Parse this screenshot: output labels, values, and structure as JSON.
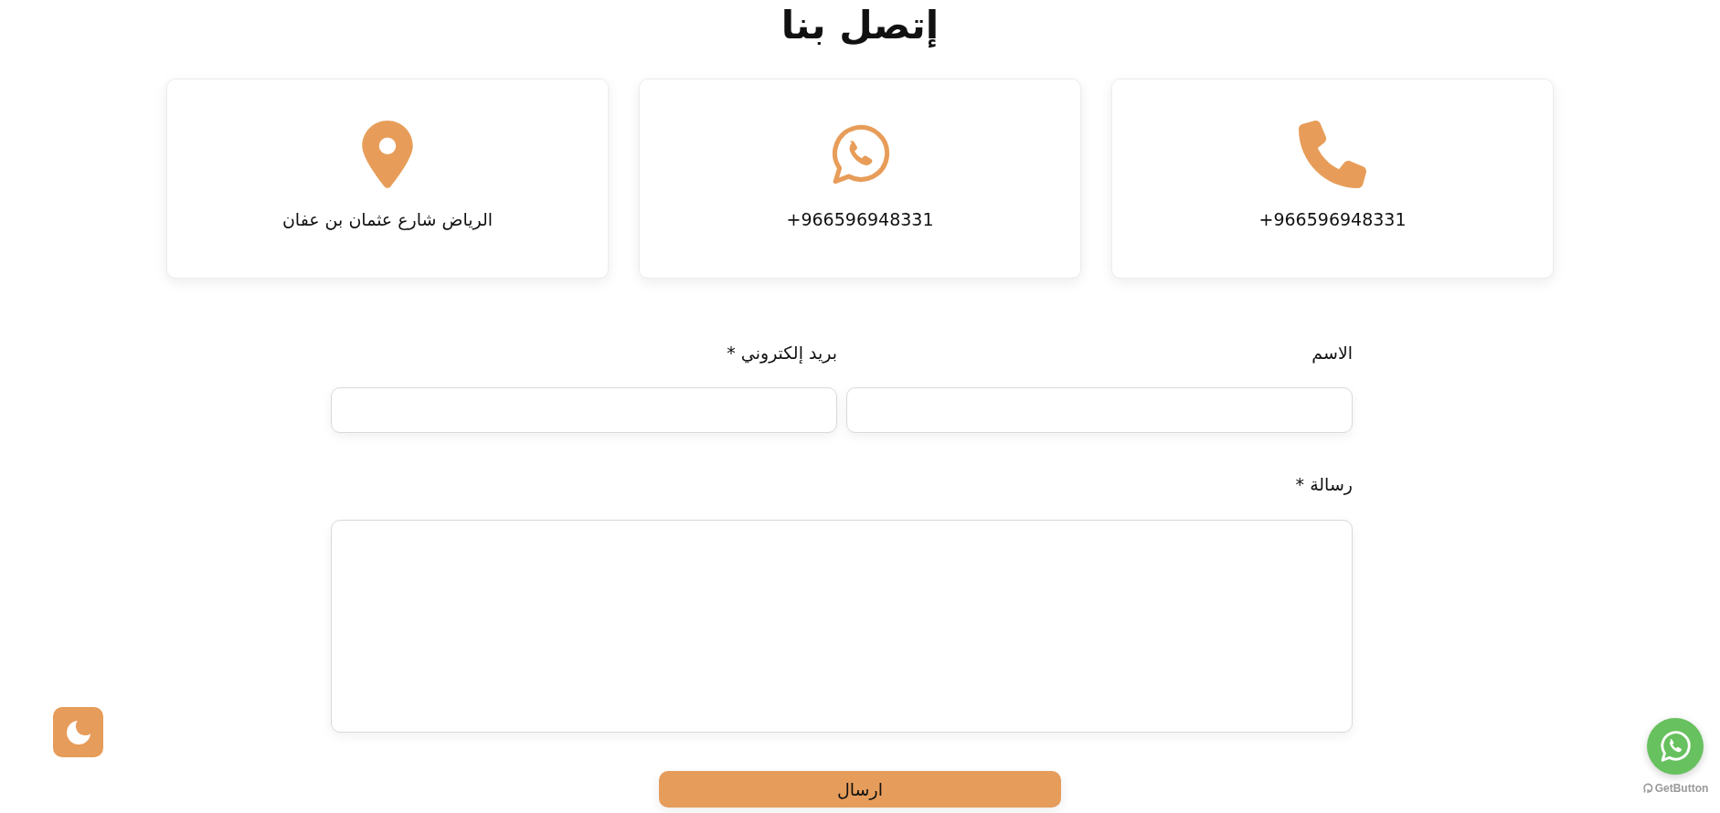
{
  "page": {
    "title": "إتصل بنا"
  },
  "contact_cards": [
    {
      "kind": "phone",
      "text": "+966596948331"
    },
    {
      "kind": "whatsapp",
      "text": "+966596948331"
    },
    {
      "kind": "location",
      "text": "الرياض شارع عثمان بن عفان"
    }
  ],
  "form": {
    "fields": [
      {
        "kind": "input",
        "label": "الاسم"
      },
      {
        "kind": "input",
        "label": "بريد إلكتروني *"
      },
      {
        "kind": "textarea",
        "label": "رسالة *"
      }
    ],
    "submit_button": {
      "label": "ارسال"
    }
  },
  "chat_widget": {
    "branding": "GetButton"
  }
}
